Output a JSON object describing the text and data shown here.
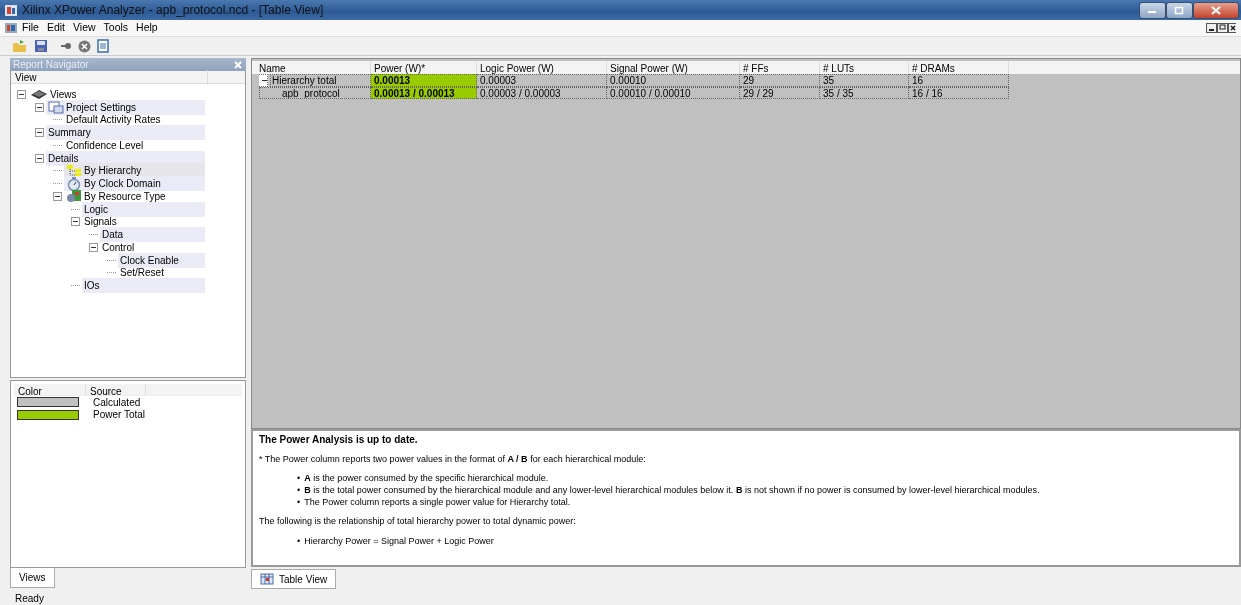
{
  "window": {
    "title": "Xilinx XPower Analyzer - apb_protocol.ncd - [Table View]"
  },
  "menu": [
    "File",
    "Edit",
    "View",
    "Tools",
    "Help"
  ],
  "navigator": {
    "title": "Report Navigator",
    "column": "View",
    "tree": [
      {
        "label": "Views",
        "expanded": true,
        "highlighted": false,
        "selected": false,
        "children": [
          {
            "label": "Project Settings",
            "expanded": true,
            "highlighted": true,
            "selected": false,
            "children": [
              {
                "label": "Default Activity Rates",
                "highlighted": false,
                "selected": false
              }
            ]
          },
          {
            "label": "Summary",
            "expanded": true,
            "highlighted": true,
            "selected": false,
            "children": [
              {
                "label": "Confidence Level",
                "highlighted": false,
                "selected": false
              }
            ]
          },
          {
            "label": "Details",
            "expanded": true,
            "highlighted": true,
            "selected": false,
            "children": [
              {
                "label": "By Hierarchy",
                "highlighted": true,
                "selected": true
              },
              {
                "label": "By Clock Domain",
                "highlighted": true,
                "selected": false
              },
              {
                "label": "By Resource Type",
                "expanded": true,
                "highlighted": false,
                "selected": false,
                "children": [
                  {
                    "label": "Logic",
                    "highlighted": true,
                    "selected": false
                  },
                  {
                    "label": "Signals",
                    "expanded": true,
                    "highlighted": false,
                    "selected": false,
                    "children": [
                      {
                        "label": "Data",
                        "highlighted": true,
                        "selected": false
                      },
                      {
                        "label": "Control",
                        "expanded": true,
                        "highlighted": false,
                        "selected": false,
                        "children": [
                          {
                            "label": "Clock Enable",
                            "highlighted": true,
                            "selected": false
                          },
                          {
                            "label": "Set/Reset",
                            "highlighted": false,
                            "selected": false
                          }
                        ]
                      }
                    ]
                  },
                  {
                    "label": "IOs",
                    "highlighted": true,
                    "selected": false
                  }
                ]
              }
            ]
          }
        ]
      }
    ]
  },
  "legend": {
    "columns": [
      "Color",
      "Source"
    ],
    "items": [
      {
        "label": "Calculated",
        "color": "#c0c0c0"
      },
      {
        "label": "Power Total",
        "color": "#99cc00"
      }
    ]
  },
  "left_tabs": [
    {
      "label": "Views",
      "selected": true
    }
  ],
  "table": {
    "columns": [
      "Name",
      "Power (W)*",
      "Logic Power (W)",
      "Signal Power (W)",
      "# FFs",
      "# LUTs",
      "# DRAMs"
    ],
    "rows": [
      {
        "expanded": true,
        "cells": [
          "Hierarchy total",
          "0.00013",
          "0.00003",
          "0.00010",
          "29",
          "35",
          "16"
        ],
        "children": [
          {
            "cells": [
              "apb_protocol",
              "0.00013 / 0.00013",
              "0.00003 / 0.00003",
              "0.00010 / 0.00010",
              "29 / 29",
              "35 / 35",
              "16 / 16"
            ]
          }
        ]
      }
    ]
  },
  "notes": {
    "heading": "The Power Analysis is up to date.",
    "intro": "* The Power column reports two power values in the format of **A / B** for each hierarchical module:",
    "bullets": [
      {
        "marker": "•",
        "text": "**A** is the power consumed by the specific hierarchical module."
      },
      {
        "marker": "•",
        "text": "**B** is the total power consumed by the hierarchical module and any lower-level hierarchical modules below it. **B** is not shown if no power is consumed by lower-level hierarchical modules."
      },
      {
        "marker": "•",
        "text": "The Power column reports a single power value for Hierarchy total."
      }
    ],
    "relation": "The following is the relationship of total hierarchy power to total dynamic power:",
    "formula_bullets": [
      {
        "marker": "•",
        "text": "Hierarchy Power = Signal Power + Logic Power"
      }
    ]
  },
  "right_tabs": [
    {
      "label": "Table View",
      "selected": true
    }
  ],
  "status_bar": "Ready"
}
